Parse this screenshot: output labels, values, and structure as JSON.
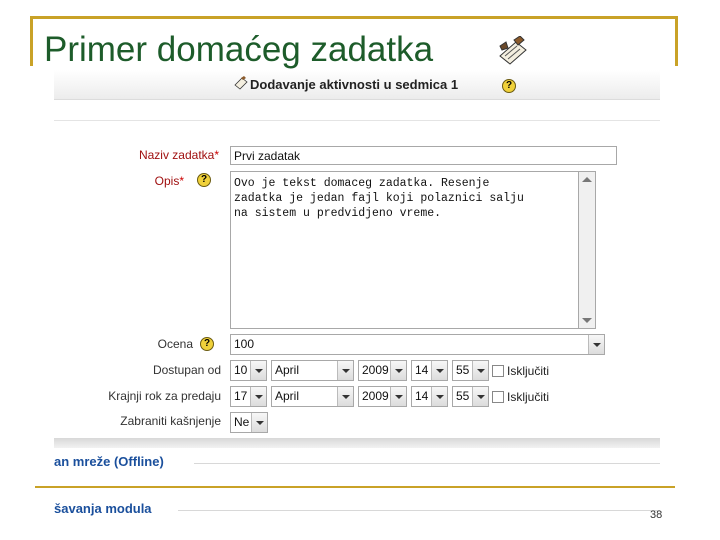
{
  "slide": {
    "title": "Primer domaćeg zadatka",
    "page_number": "38"
  },
  "form": {
    "header": "Dodavanje aktivnosti u sedmica 1",
    "help_glyph": "?",
    "fields": {
      "name_label": "Naziv zadatka",
      "name_value": "Prvi zadatak",
      "description_label": "Opis",
      "description_value": "Ovo je tekst domaceg zadatka. Resenje\nzadatka je jedan fajl koji polaznici salju\nna sistem u predvidjeno vreme.",
      "grade_label": "Ocena",
      "grade_value": "100",
      "available_label": "Dostupan od",
      "available": {
        "day": "10",
        "month": "April",
        "year": "2009",
        "hour": "14",
        "minute": "55",
        "disable_label": "Isključiti"
      },
      "due_label": "Krajnji rok za predaju",
      "due": {
        "day": "17",
        "month": "April",
        "year": "2009",
        "hour": "14",
        "minute": "55",
        "disable_label": "Isključiti"
      },
      "prevent_late_label": "Zabraniti kašnjenje",
      "prevent_late_value": "Ne"
    },
    "required_marker": "*",
    "sections": [
      "an mreže (Offline)",
      "šavanja modula"
    ]
  },
  "colors": {
    "title": "#1d5c2a",
    "frame": "#c9a227",
    "required_label": "#a01010",
    "section_title": "#1a4f9c"
  }
}
